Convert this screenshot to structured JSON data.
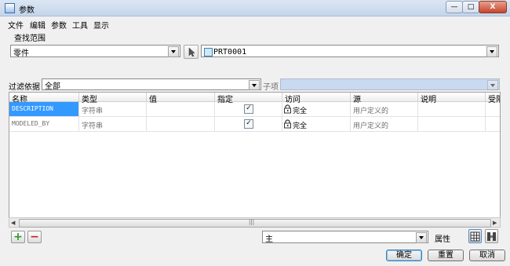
{
  "window": {
    "title": "参数",
    "min_glyph": "—",
    "max_glyph": "□",
    "close_glyph": "X"
  },
  "menu": [
    "文件",
    "编辑",
    "参数",
    "工具",
    "显示"
  ],
  "lookup": {
    "group_label": "查找范围",
    "scope_value": "零件",
    "object_value": "PRT0001"
  },
  "filter": {
    "label": "过滤依据",
    "value": "全部",
    "sub_label": "子项",
    "sub_value": ""
  },
  "table": {
    "columns": [
      "名称",
      "类型",
      "值",
      "指定",
      "访问",
      "源",
      "说明",
      "受限"
    ],
    "rows": [
      {
        "name": "DESCRIPTION",
        "type": "字符串",
        "value": "",
        "designated": "✓",
        "access": "完全",
        "source": "用户定义的",
        "description": ""
      },
      {
        "name": "MODELED_BY",
        "type": "字符串",
        "value": "",
        "designated": "✓",
        "access": "完全",
        "source": "用户定义的",
        "description": ""
      }
    ]
  },
  "scrollbar": {
    "grip": "|||"
  },
  "bottom": {
    "add_glyph": "+",
    "remove_glyph": "−",
    "view_value": "主",
    "properties_label": "属性"
  },
  "buttons": {
    "ok": "确定",
    "reset": "重置",
    "cancel": "取消"
  },
  "colors": {
    "selection": "#3399ff",
    "add_green": "#2a9a2a",
    "remove_red": "#c8201a"
  }
}
